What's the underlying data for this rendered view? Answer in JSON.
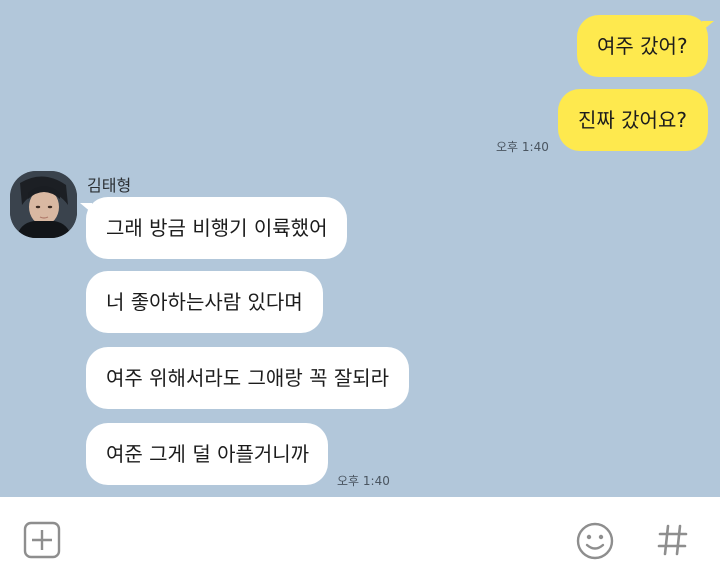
{
  "chat": {
    "outgoing": [
      {
        "text": "여주 갔어?"
      },
      {
        "text": "진짜 갔어요?"
      }
    ],
    "outgoing_time": "오후 1:40",
    "sender_name": "김태형",
    "incoming": [
      {
        "text": "그래 방금 비행기 이륙했어"
      },
      {
        "text": "너 좋아하는사람 있다며"
      },
      {
        "text": "여주 위해서라도 그애랑 꼭 잘되라"
      },
      {
        "text": "여준 그게 덜 아플거니까"
      }
    ],
    "incoming_time": "오후 1:40"
  },
  "input_bar": {
    "icons": [
      "plus-icon",
      "emoji-icon",
      "hashtag-icon"
    ]
  },
  "colors": {
    "background": "#b2c7da",
    "my_bubble": "#fee94e",
    "their_bubble": "#ffffff"
  }
}
